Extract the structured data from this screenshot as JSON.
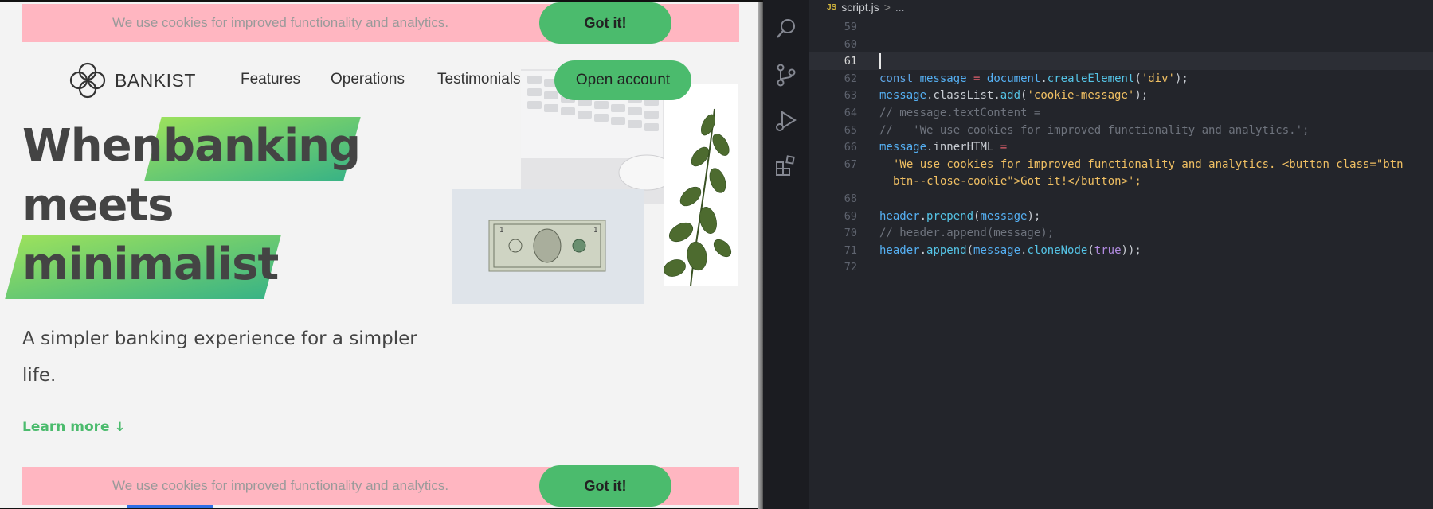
{
  "site": {
    "cookie_text": "We use cookies for improved functionality and analytics.",
    "cookie_button": "Got it!",
    "logo_name": "BANKIST",
    "nav": [
      "Features",
      "Operations",
      "Testimonials"
    ],
    "open_account": "Open account",
    "hero_words": [
      "When",
      "banking",
      "meets",
      "minimalist"
    ],
    "hero_subtitle": "A simpler banking experience for a simpler life.",
    "learn_more": "Learn more ↓",
    "accent_color": "#4bbb6d",
    "cookie_bg": "#ffb6c1"
  },
  "editor": {
    "breadcrumb": {
      "lang_badge": "JS",
      "file": "script.js",
      "separator": ">",
      "rest": "..."
    },
    "activity_icons": [
      "search-icon",
      "source-control-icon",
      "run-debug-icon",
      "extensions-icon"
    ],
    "active_line": "61",
    "lines": [
      {
        "n": "59",
        "text": ""
      },
      {
        "n": "60",
        "text": ""
      },
      {
        "n": "61",
        "text": ""
      },
      {
        "n": "62",
        "text": "const message = document.createElement('div');"
      },
      {
        "n": "63",
        "text": "message.classList.add('cookie-message');"
      },
      {
        "n": "64",
        "text": "// message.textContent ="
      },
      {
        "n": "65",
        "text": "//   'We use cookies for improved functionality and analytics.';"
      },
      {
        "n": "66",
        "text": "message.innerHTML ="
      },
      {
        "n": "67",
        "text": "'We use cookies for improved functionality and analytics. <button class=\"btn"
      },
      {
        "n": "",
        "text": "btn--close-cookie\">Got it!</button>';"
      },
      {
        "n": "68",
        "text": ""
      },
      {
        "n": "69",
        "text": "header.prepend(message);"
      },
      {
        "n": "70",
        "text": "// header.append(message);"
      },
      {
        "n": "71",
        "text": "header.append(message.cloneNode(true));"
      },
      {
        "n": "72",
        "text": ""
      }
    ]
  }
}
